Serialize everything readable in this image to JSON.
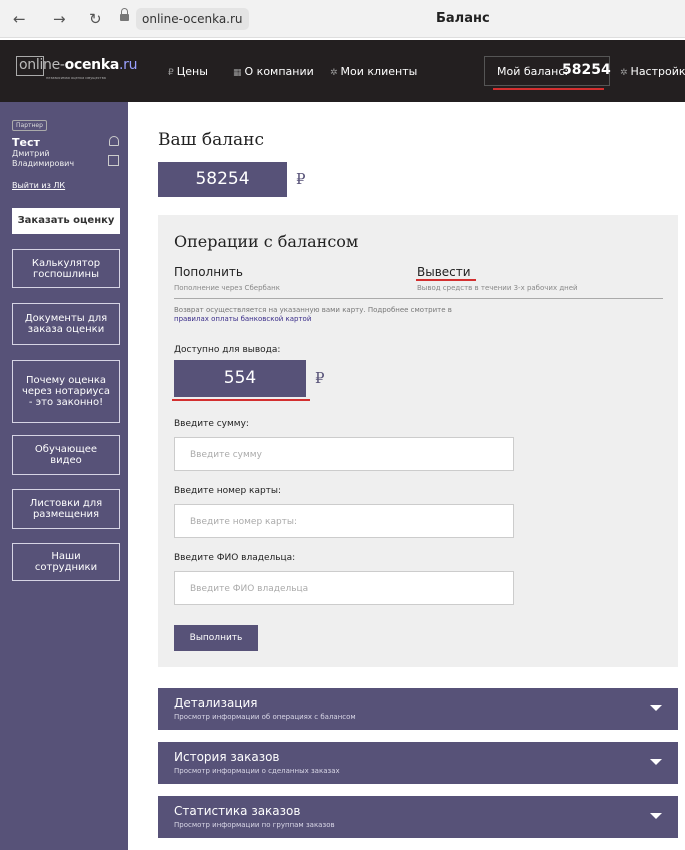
{
  "browser": {
    "back": "←",
    "forward": "→",
    "reload": "↻",
    "url": "online-ocenka.ru",
    "tab_title": "Баланс"
  },
  "header": {
    "logo_text": {
      "a": "onl",
      "b": "ine-",
      "c": "ocenka",
      "d": ".ru"
    },
    "logo_subtitle": "независимая оценка имущества",
    "menu": [
      {
        "icon": "₽",
        "label": "Цены"
      },
      {
        "icon": "▦",
        "label": "О компании"
      },
      {
        "icon": "✲",
        "label": "Мои клиенты"
      }
    ],
    "balance_label": "Мой баланс:",
    "balance_value": "58254",
    "settings_icon": "✲",
    "settings_label": "Настройки"
  },
  "sidebar": {
    "partner_tag": "Партнер",
    "user_short": "Тест",
    "user_full": "Дмитрий Владимирович",
    "logout": "Выйти из ЛК",
    "order_button": "Заказать оценку",
    "items": [
      "Калькулятор госпошлины",
      "Документы для заказа оценки",
      "Почему оценка через нотариуса - это законно!",
      "Обучающее видео",
      "Листовки для размещения",
      "Наши сотрудники"
    ]
  },
  "main": {
    "title": "Ваш баланс",
    "balance": "58254",
    "currency": "₽",
    "ops": {
      "title": "Операции с балансом",
      "tab_topup": "Пополнить",
      "tab_topup_sub": "Пополнение через Сбербанк",
      "tab_withdraw": "Вывести",
      "tab_withdraw_sub": "Вывод средств в течении 3-х рабочих дней",
      "notice": "Возврат осуществляется на указанную вами карту. Подробнее смотрите в",
      "notice_link": "правилах оплаты банковской картой",
      "available_label": "Доступно для вывода:",
      "available_value": "554",
      "amount_label": "Введите сумму:",
      "amount_placeholder": "Введите сумму",
      "card_label": "Введите номер карты:",
      "card_placeholder": "Введите номер карты:",
      "owner_label": "Введите ФИО владельца:",
      "owner_placeholder": "Введите ФИО владельца",
      "submit": "Выполнить"
    },
    "accordions": [
      {
        "title": "Детализация",
        "sub": "Просмотр информации об операциях с балансом"
      },
      {
        "title": "История заказов",
        "sub": "Просмотр информации о сделанных заказах"
      },
      {
        "title": "Статистика заказов",
        "sub": "Просмотр информации по группам заказов"
      }
    ]
  },
  "colors": {
    "accent": "#575278",
    "header_bg": "#231f20",
    "highlight": "#d32f2f"
  }
}
